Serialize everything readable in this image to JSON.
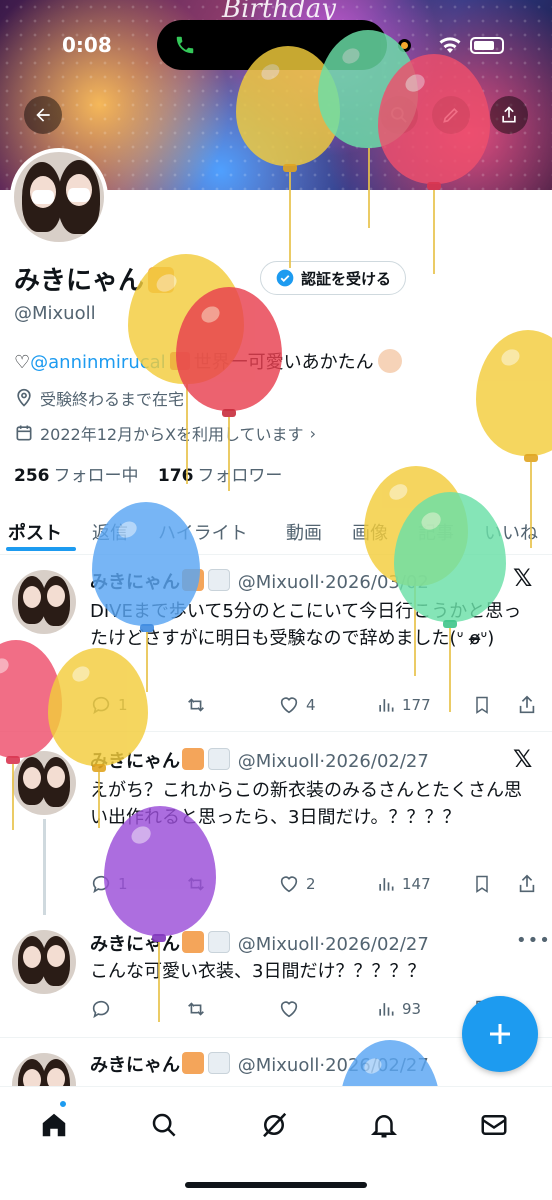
{
  "status_bar": {
    "time": "0:08"
  },
  "banner": {
    "text": "Birthday"
  },
  "profile": {
    "name": "みきにゃん",
    "handle": "@Mixuoll",
    "verify_button": "認証を受ける",
    "bio_prefix": "♡",
    "bio_link": "@anninmirucal",
    "bio_rest": "世界一可愛いあかたん",
    "location": "受験終わるまで在宅",
    "joined": "2022年12月からXを利用しています",
    "following_count": "256",
    "following_label": "フォロー中",
    "followers_count": "176",
    "followers_label": "フォロワー"
  },
  "tabs": [
    "ポスト",
    "返信",
    "ハイライト",
    "動画",
    "画像",
    "記事",
    "いいね"
  ],
  "posts": [
    {
      "name": "みきにゃん",
      "handle": "@Mixuoll",
      "date": "2026/03/02",
      "text": "DIVEまで歩いて5分のとこにいて今日行こうかと思ったけどさすがに明日も受験なので辞めました(ᐡ o̴̶̷ᐡ)",
      "replies": "1",
      "likes": "4",
      "views": "177"
    },
    {
      "name": "みきにゃん",
      "handle": "@Mixuoll",
      "date": "2026/02/27",
      "text": "えがち？これからこの新衣装のみるさんとたくさん思い出作れると思ったら、3日間だけ。？？？？",
      "replies": "1",
      "likes": "2",
      "views": "147"
    },
    {
      "name": "みきにゃん",
      "handle": "@Mixuoll",
      "date": "2026/02/27",
      "text": "こんな可愛い衣装、3日間だけ？？？？？",
      "replies": "",
      "likes": "",
      "views": "93"
    },
    {
      "name": "みきにゃん",
      "handle": "@Mixuoll",
      "date": "2026/02/27"
    }
  ],
  "colors": {
    "accent": "#1d9bf0",
    "text": "#0f1419",
    "muted": "#536471"
  },
  "icons": {
    "back": "arrow-left-icon",
    "search": "search-icon",
    "edit": "pencil-icon",
    "share": "share-icon",
    "verify": "verified-badge-icon",
    "location": "location-pin-icon",
    "calendar": "calendar-icon",
    "fab": "plus-icon",
    "nav": [
      "home-icon",
      "search-icon",
      "grok-icon",
      "bell-icon",
      "mail-icon"
    ]
  }
}
